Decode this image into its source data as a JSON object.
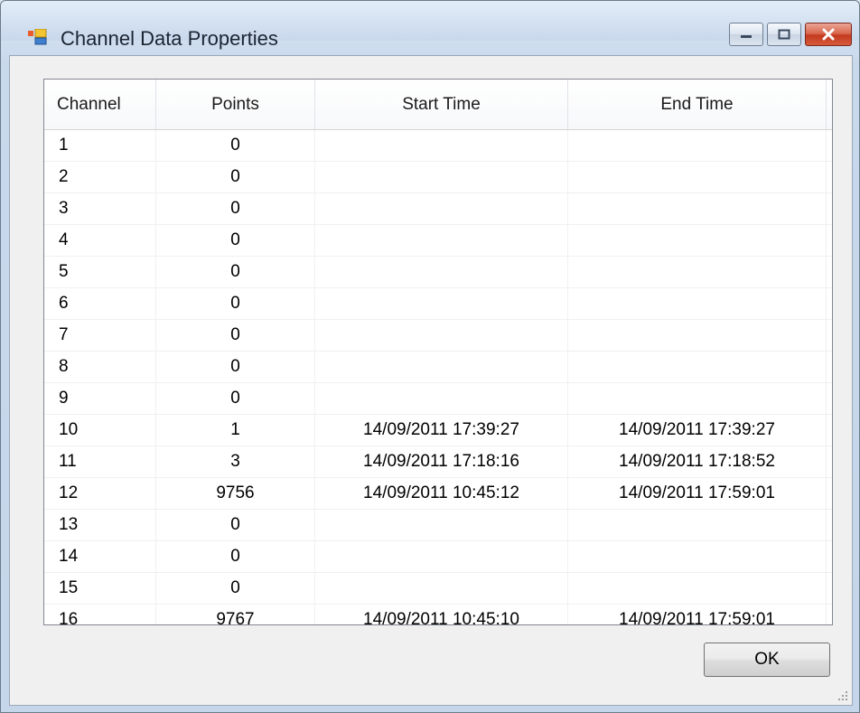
{
  "window": {
    "title": "Channel Data Properties",
    "controls": {
      "minimize": "minimize-icon",
      "maximize": "maximize-icon",
      "close": "close-icon"
    }
  },
  "table": {
    "columns": [
      "Channel",
      "Points",
      "Start Time",
      "End Time"
    ],
    "rows": [
      [
        "1",
        "0",
        "",
        ""
      ],
      [
        "2",
        "0",
        "",
        ""
      ],
      [
        "3",
        "0",
        "",
        ""
      ],
      [
        "4",
        "0",
        "",
        ""
      ],
      [
        "5",
        "0",
        "",
        ""
      ],
      [
        "6",
        "0",
        "",
        ""
      ],
      [
        "7",
        "0",
        "",
        ""
      ],
      [
        "8",
        "0",
        "",
        ""
      ],
      [
        "9",
        "0",
        "",
        ""
      ],
      [
        "10",
        "1",
        "14/09/2011 17:39:27",
        "14/09/2011 17:39:27"
      ],
      [
        "11",
        "3",
        "14/09/2011 17:18:16",
        "14/09/2011 17:18:52"
      ],
      [
        "12",
        "9756",
        "14/09/2011 10:45:12",
        "14/09/2011 17:59:01"
      ],
      [
        "13",
        "0",
        "",
        ""
      ],
      [
        "14",
        "0",
        "",
        ""
      ],
      [
        "15",
        "0",
        "",
        ""
      ],
      [
        "16",
        "9767",
        "14/09/2011 10:45:10",
        "14/09/2011 17:59:01"
      ]
    ]
  },
  "buttons": {
    "ok_label": "OK"
  },
  "colors": {
    "close_button": "#c43a1f",
    "titlebar": "#d2e0f0",
    "dialog_bg": "#f0f0f0"
  }
}
